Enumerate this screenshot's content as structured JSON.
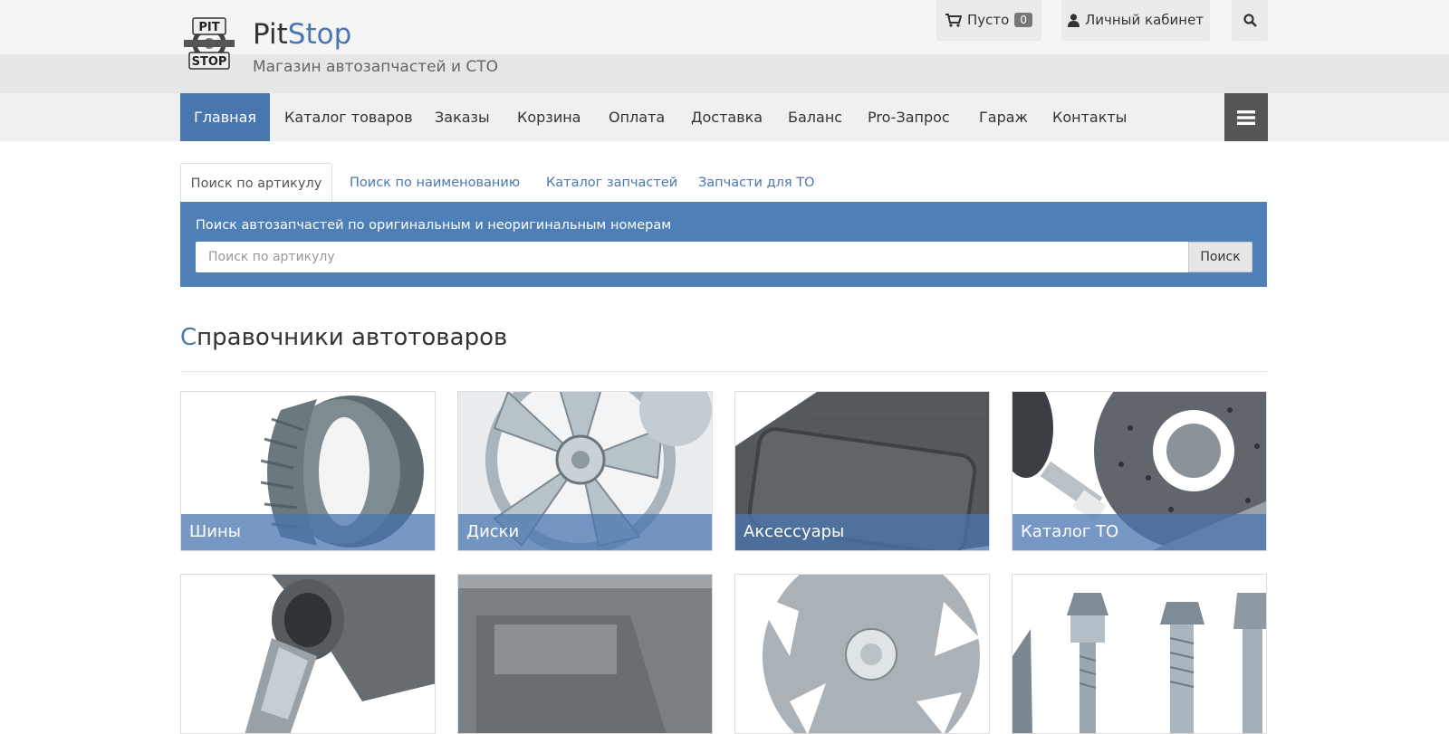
{
  "brand": {
    "name_part1": "Pit",
    "name_part2": "Stop",
    "tagline": "Магазин автозапчастей и СТО",
    "logo_text_top": "PIT",
    "logo_text_bottom": "STOP"
  },
  "topbar": {
    "cart_label": "Пусто",
    "cart_count": "0",
    "account_label": "Личный кабинет"
  },
  "nav": {
    "items": [
      {
        "label": "Главная"
      },
      {
        "label": "Каталог товаров"
      },
      {
        "label": "Заказы"
      },
      {
        "label": "Корзина"
      },
      {
        "label": "Оплата"
      },
      {
        "label": "Доставка"
      },
      {
        "label": "Баланс"
      },
      {
        "label": "Pro-Запрос"
      },
      {
        "label": "Гараж"
      },
      {
        "label": "Контакты"
      }
    ]
  },
  "search": {
    "tabs": [
      {
        "label": "Поиск по артикулу"
      },
      {
        "label": "Поиск по наименованию"
      },
      {
        "label": "Каталог запчастей"
      },
      {
        "label": "Запчасти для ТО"
      }
    ],
    "caption": "Поиск автозапчастей по оригинальным и неоригинальным номерам",
    "placeholder": "Поиск по артикулу",
    "value": "",
    "button_label": "Поиск"
  },
  "section": {
    "title_first_letter": "С",
    "title_rest": "правочники автотоваров"
  },
  "categories": [
    {
      "label": "Шины",
      "image": "tire"
    },
    {
      "label": "Диски",
      "image": "wheel-rim"
    },
    {
      "label": "Аксессуары",
      "image": "floor-mat"
    },
    {
      "label": "Каталог ТО",
      "image": "brake-disc-spark-plug"
    },
    {
      "label": "",
      "image": "exhaust-pipe"
    },
    {
      "label": "",
      "image": "car-body-panel"
    },
    {
      "label": "",
      "image": "wheel-cap"
    },
    {
      "label": "",
      "image": "wheel-bolts"
    }
  ],
  "colors": {
    "accent": "#4a76b0",
    "panel": "#4f7fb7",
    "menu_button": "#555555"
  }
}
